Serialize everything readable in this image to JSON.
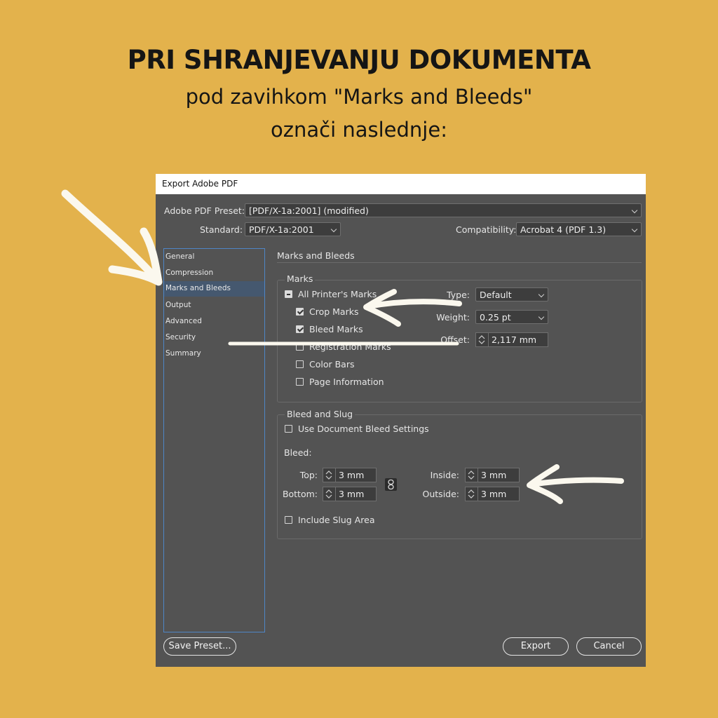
{
  "headline": {
    "line1": "PRI SHRANJEVANJU DOKUMENTA",
    "line2": "pod zavihkom \"Marks and Bleeds\"",
    "line3": "označi naslednje:"
  },
  "colors": {
    "background": "#E3B24C",
    "dialog": "#535353",
    "sidebar_border": "#4f86c6",
    "annotation": "#FBF8EE"
  },
  "dialog": {
    "title": "Export Adobe PDF",
    "preset": {
      "label": "Adobe PDF Preset:",
      "value": "[PDF/X-1a:2001] (modified)"
    },
    "standard": {
      "label": "Standard:",
      "value": "PDF/X-1a:2001"
    },
    "compatibility": {
      "label": "Compatibility:",
      "value": "Acrobat 4 (PDF 1.3)"
    },
    "sidebar": [
      "General",
      "Compression",
      "Marks and Bleeds",
      "Output",
      "Advanced",
      "Security",
      "Summary"
    ],
    "selected_sidebar_item": "Marks and Bleeds",
    "section_title": "Marks and Bleeds",
    "marks": {
      "group_title": "Marks",
      "all_printers_marks": "All Printer's Marks",
      "crop_marks": "Crop Marks",
      "bleed_marks": "Bleed Marks",
      "registration_marks": "Registration Marks",
      "color_bars": "Color Bars",
      "page_information": "Page Information",
      "type_label": "Type:",
      "type_value": "Default",
      "weight_label": "Weight:",
      "weight_value": "0.25 pt",
      "offset_label": "Offset:",
      "offset_value": "2,117 mm"
    },
    "bleed_slug": {
      "group_title": "Bleed and Slug",
      "use_doc_bleed": "Use Document Bleed Settings",
      "bleed_label": "Bleed:",
      "top_label": "Top:",
      "top_value": "3 mm",
      "bottom_label": "Bottom:",
      "bottom_value": "3 mm",
      "inside_label": "Inside:",
      "inside_value": "3 mm",
      "outside_label": "Outside:",
      "outside_value": "3 mm",
      "include_slug": "Include Slug Area"
    },
    "buttons": {
      "save_preset": "Save Preset...",
      "export": "Export",
      "cancel": "Cancel"
    }
  }
}
